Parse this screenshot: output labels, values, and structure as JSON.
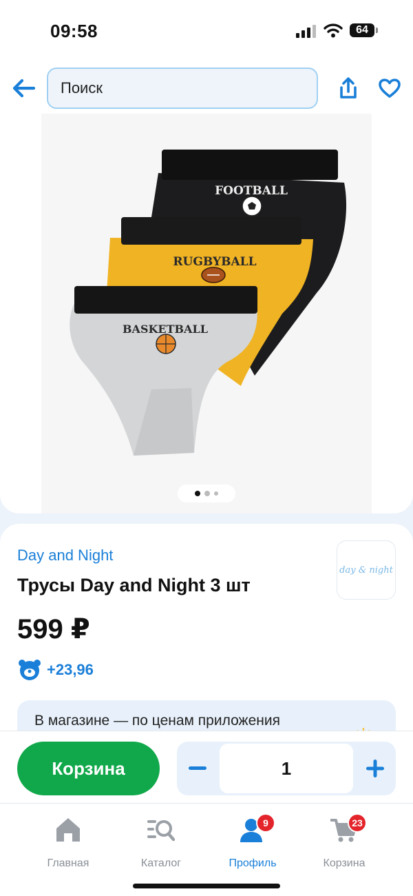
{
  "status_bar": {
    "time": "09:58",
    "battery": "64"
  },
  "header": {
    "search_placeholder": "Поиск"
  },
  "gallery": {
    "image_alt": "Трусы Day and Night 3 шт",
    "slides": 3,
    "active_slide": 1,
    "prints": [
      "FOOTBALL",
      "RUGBYBALL",
      "BASKETBALL"
    ]
  },
  "product": {
    "brand": "Day and Night",
    "title": "Трусы Day and Night 3 шт",
    "price": "599 ₽",
    "bonus": "+23,96",
    "brand_logo_text": "day & night"
  },
  "store_banner": {
    "text": "В магазине — по ценам приложения"
  },
  "actions": {
    "cart_label": "Корзина",
    "minus": "−",
    "plus": "+",
    "quantity": "1"
  },
  "tabbar": {
    "items": [
      {
        "label": "Главная",
        "icon": "home-icon"
      },
      {
        "label": "Каталог",
        "icon": "catalog-search-icon"
      },
      {
        "label": "Профиль",
        "icon": "profile-icon",
        "badge": "9",
        "active": true
      },
      {
        "label": "Корзина",
        "icon": "cart-icon",
        "badge": "23"
      }
    ]
  },
  "colors": {
    "accent": "#1a7fd8",
    "cart_green": "#10a84a",
    "badge_red": "#e3242b"
  }
}
